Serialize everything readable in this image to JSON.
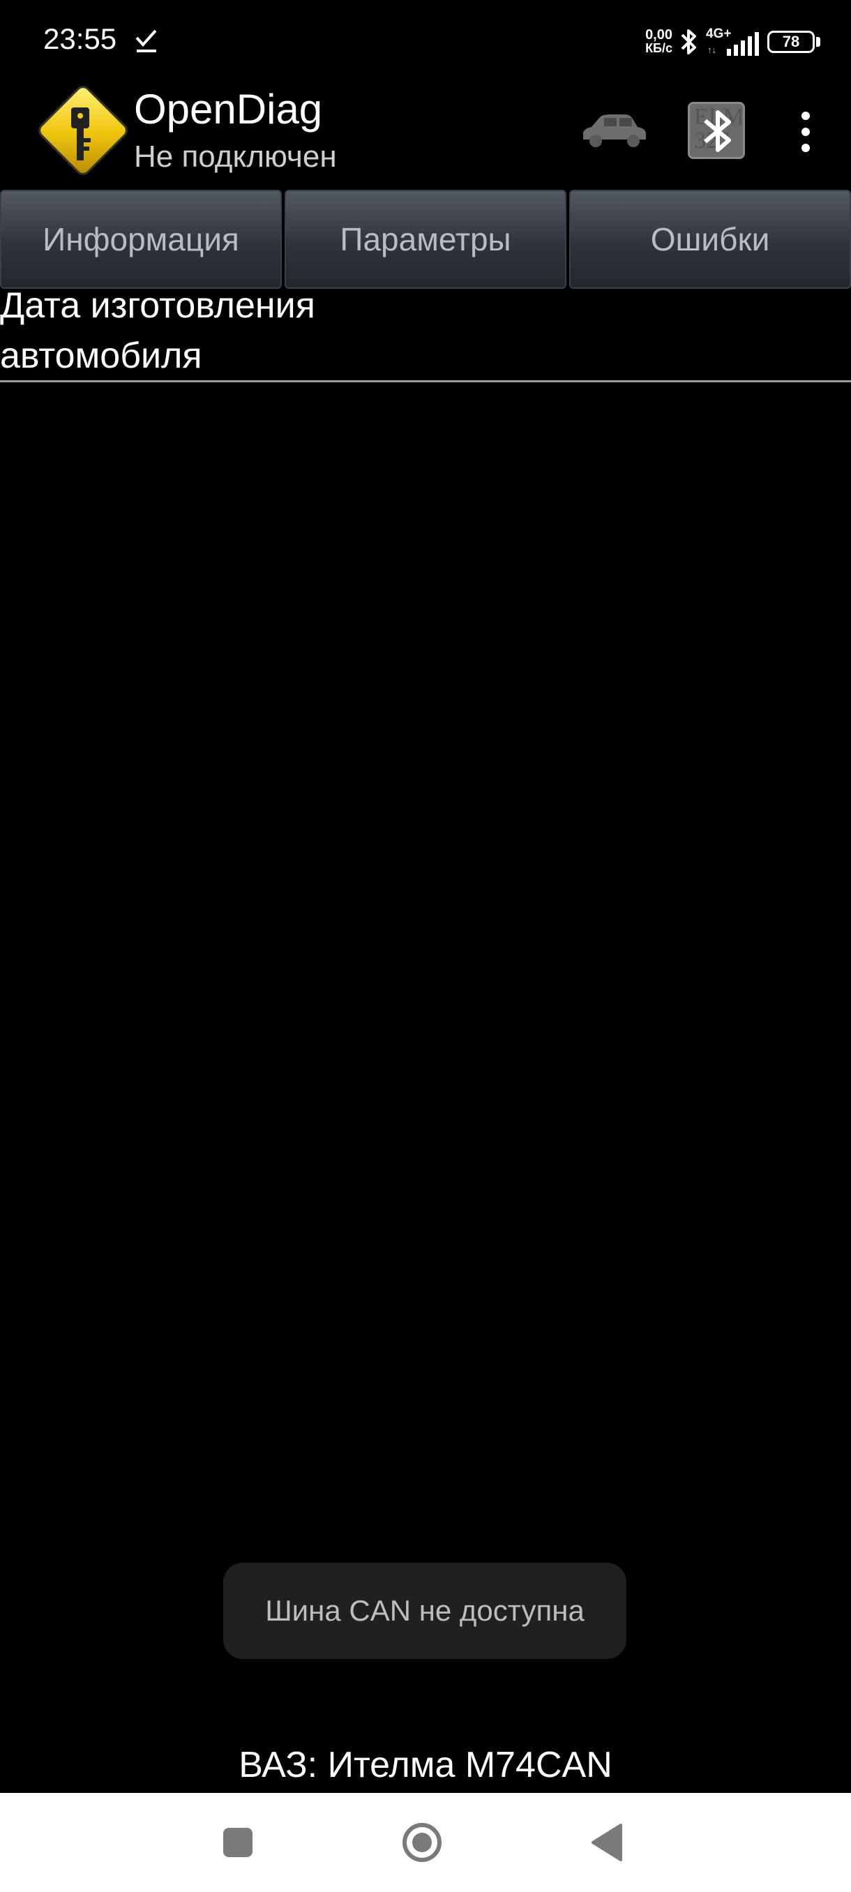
{
  "status_bar": {
    "time": "23:55",
    "net_speed_value": "0,00",
    "net_speed_unit": "КБ/с",
    "network_type": "4G+",
    "battery_level": "78",
    "icons": [
      "check-icon",
      "bluetooth-icon",
      "signal-icon",
      "battery-icon"
    ]
  },
  "action_bar": {
    "title": "OpenDiag",
    "subtitle": "Не подключен",
    "bt_adapter_text": "ELM 327",
    "icons": [
      "app-logo-icon",
      "car-icon",
      "bluetooth-icon",
      "more-vert-icon"
    ]
  },
  "tabs": [
    {
      "label": "Информация"
    },
    {
      "label": "Параметры"
    },
    {
      "label": "Ошибки"
    }
  ],
  "content": {
    "info_label": "Дата изготовления автомобиля"
  },
  "toast": {
    "message": "Шина CAN не доступна"
  },
  "footer": {
    "ecu": "ВАЗ: Ителма M74CAN"
  },
  "nav_bar": {
    "icons": [
      "recents-icon",
      "home-icon",
      "back-icon"
    ]
  },
  "colors": {
    "background": "#000000",
    "tab_text": "#b9bcc0",
    "toast_bg": "#202020",
    "nav_bg": "#ffffff",
    "logo_yellow": "#f2c811"
  }
}
